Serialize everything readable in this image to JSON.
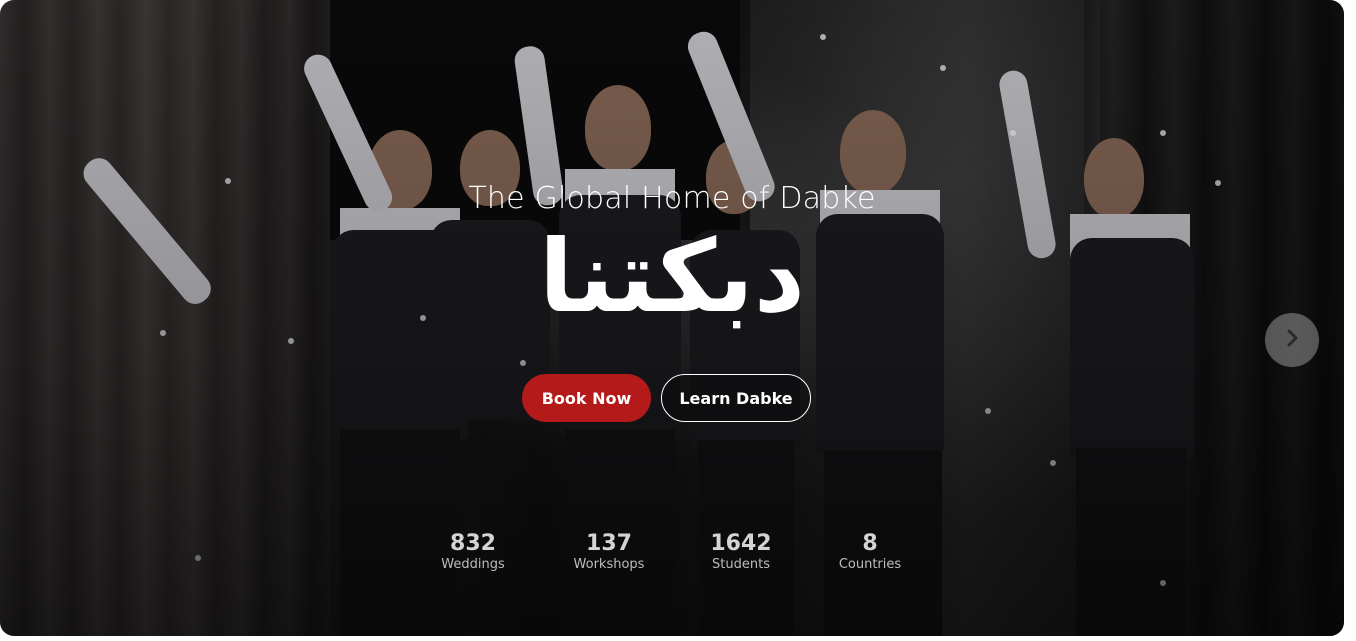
{
  "hero": {
    "subtitle": "The Global Home of Dabke",
    "title": "دبكتنا",
    "primary_cta": "Book Now",
    "secondary_cta": "Learn Dabke",
    "next_icon": "chevron-right-icon",
    "accent_color": "#b51a1a"
  },
  "stats": [
    {
      "value": "832",
      "label": "Weddings"
    },
    {
      "value": "137",
      "label": "Workshops"
    },
    {
      "value": "1642",
      "label": "Students"
    },
    {
      "value": "8",
      "label": "Countries"
    }
  ]
}
